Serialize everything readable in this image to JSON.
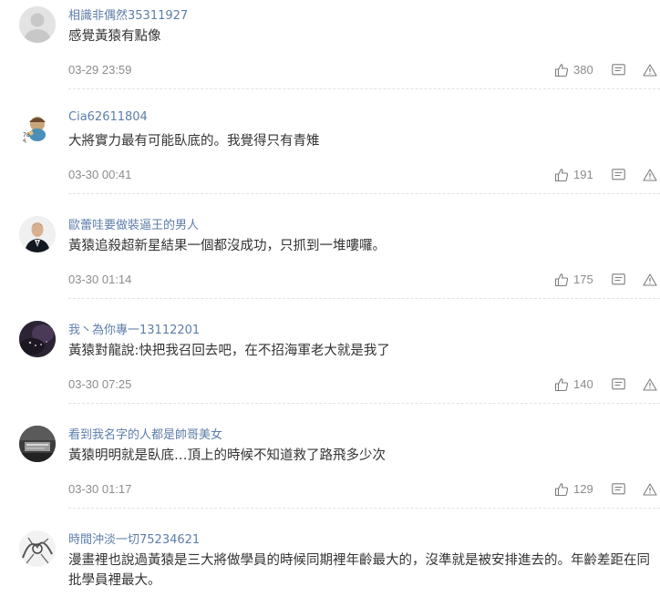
{
  "comments": [
    {
      "user": "相識非偶然35311927",
      "text": "感覺黃猿有點像",
      "date": "03-29 23:59",
      "likes": "380",
      "avatar": "default-avatar"
    },
    {
      "user": "Cia62611804",
      "text": "大將實力最有可能臥底的。我覺得只有青雉",
      "date": "03-30 00:41",
      "likes": "191",
      "avatar": "cartoon-avatar"
    },
    {
      "user": "歐蕾哇要做裝逼王的男人",
      "text": "黃猿追殺超新星結果一個都沒成功，只抓到一堆嘍囉。",
      "date": "03-30 01:14",
      "likes": "175",
      "avatar": "suit-man-avatar"
    },
    {
      "user": "我丶為你專一13112201",
      "text": "黃猿對龍說:快把我召回去吧，在不招海軍老大就是我了",
      "date": "03-30 07:25",
      "likes": "140",
      "avatar": "dark-photo-avatar"
    },
    {
      "user": "看到我名字的人都是帥哥美女",
      "text": "黃猿明明就是臥底…頂上的時候不知道救了路飛多少次",
      "date": "03-30 01:17",
      "likes": "129",
      "avatar": "grey-photo-avatar"
    },
    {
      "user": "時間沖淡一切75234621",
      "text": "漫畫裡也說過黃猿是三大將做學員的時候同期裡年齡最大的，沒準就是被安排進去的。年齡差距在同批學員裡最大。",
      "avatar": "sketch-avatar"
    }
  ],
  "icons": {
    "like": "thumbs-up-icon",
    "reply": "reply-icon",
    "report": "report-icon"
  },
  "colors": {
    "username": "#5d7eaa",
    "text": "#333333",
    "meta": "#8c8c8c"
  }
}
